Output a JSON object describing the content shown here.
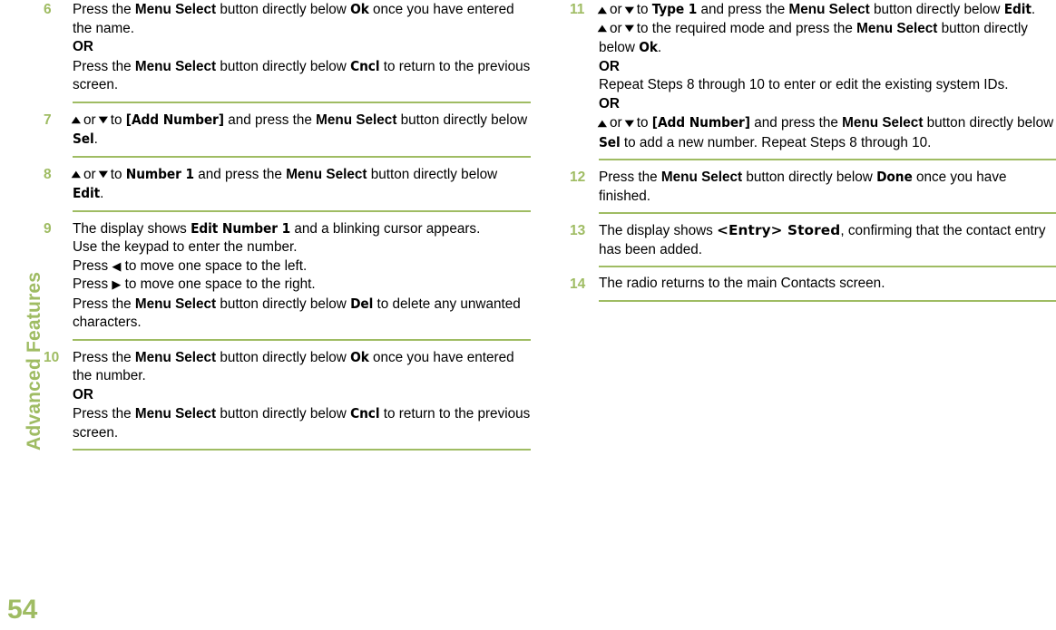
{
  "chapter": {
    "label": "Advanced Features",
    "page_number": "54",
    "accent_color": "#9fbc63"
  },
  "left_column": {
    "steps": [
      {
        "number": "6",
        "lines": [
          [
            {
              "t": "Press the ",
              "s": "plain"
            },
            {
              "t": "Menu Select",
              "s": "ui"
            },
            {
              "t": " button directly below ",
              "s": "plain"
            },
            {
              "t": "Ok",
              "s": "screen"
            },
            {
              "t": " once you have entered the name.",
              "s": "plain"
            }
          ],
          [
            {
              "t": "OR",
              "s": "or"
            }
          ],
          [
            {
              "t": "Press the ",
              "s": "plain"
            },
            {
              "t": "Menu Select",
              "s": "ui"
            },
            {
              "t": " button directly below ",
              "s": "plain"
            },
            {
              "t": "Cncl",
              "s": "screen"
            },
            {
              "t": " to return to the previous screen.",
              "s": "plain"
            }
          ]
        ]
      },
      {
        "number": "7",
        "lines": [
          [
            {
              "t": "▲",
              "s": "nav-vert"
            },
            {
              "t": " or ",
              "s": "plain"
            },
            {
              "t": "▼",
              "s": "nav-vert"
            },
            {
              "t": " to ",
              "s": "plain"
            },
            {
              "t": "[Add Number]",
              "s": "screen"
            },
            {
              "t": " and press the ",
              "s": "plain"
            },
            {
              "t": "Menu Select",
              "s": "ui"
            },
            {
              "t": " button directly below ",
              "s": "plain"
            },
            {
              "t": "Sel",
              "s": "screen"
            },
            {
              "t": ".",
              "s": "plain"
            }
          ]
        ]
      },
      {
        "number": "8",
        "lines": [
          [
            {
              "t": "▲",
              "s": "nav-vert"
            },
            {
              "t": " or ",
              "s": "plain"
            },
            {
              "t": "▼",
              "s": "nav-vert"
            },
            {
              "t": " to ",
              "s": "plain"
            },
            {
              "t": "Number 1",
              "s": "screen"
            },
            {
              "t": " and press the ",
              "s": "plain"
            },
            {
              "t": "Menu Select",
              "s": "ui"
            },
            {
              "t": " button directly below ",
              "s": "plain"
            },
            {
              "t": "Edit",
              "s": "screen"
            },
            {
              "t": ".",
              "s": "plain"
            }
          ]
        ]
      },
      {
        "number": "9",
        "lines": [
          [
            {
              "t": "The display shows ",
              "s": "plain"
            },
            {
              "t": "Edit Number 1",
              "s": "screen"
            },
            {
              "t": " and a blinking cursor appears.",
              "s": "plain"
            }
          ],
          [
            {
              "t": "Use the keypad to enter the number.",
              "s": "plain"
            }
          ],
          [
            {
              "t": "Press ",
              "s": "plain"
            },
            {
              "t": "◀",
              "s": "nav-horz"
            },
            {
              "t": " to move one space to the left.",
              "s": "plain"
            }
          ],
          [
            {
              "t": "Press ",
              "s": "plain"
            },
            {
              "t": "▶",
              "s": "nav-horz"
            },
            {
              "t": " to move one space to the right.",
              "s": "plain"
            }
          ],
          [
            {
              "t": "Press the ",
              "s": "plain"
            },
            {
              "t": "Menu Select",
              "s": "ui"
            },
            {
              "t": " button directly below ",
              "s": "plain"
            },
            {
              "t": "Del",
              "s": "screen"
            },
            {
              "t": " to delete any unwanted characters.",
              "s": "plain"
            }
          ]
        ]
      },
      {
        "number": "10",
        "lines": [
          [
            {
              "t": "Press the ",
              "s": "plain"
            },
            {
              "t": "Menu Select",
              "s": "ui"
            },
            {
              "t": " button directly below ",
              "s": "plain"
            },
            {
              "t": "Ok",
              "s": "screen"
            },
            {
              "t": " once you have entered the number.",
              "s": "plain"
            }
          ],
          [
            {
              "t": "OR",
              "s": "or"
            }
          ],
          [
            {
              "t": "Press the ",
              "s": "plain"
            },
            {
              "t": "Menu Select",
              "s": "ui"
            },
            {
              "t": " button directly below ",
              "s": "plain"
            },
            {
              "t": "Cncl",
              "s": "screen"
            },
            {
              "t": " to return to the previous screen.",
              "s": "plain"
            }
          ]
        ]
      }
    ]
  },
  "right_column": {
    "steps": [
      {
        "number": "11",
        "lines": [
          [
            {
              "t": "▲",
              "s": "nav-vert"
            },
            {
              "t": " or ",
              "s": "plain"
            },
            {
              "t": "▼",
              "s": "nav-vert"
            },
            {
              "t": " to ",
              "s": "plain"
            },
            {
              "t": "Type 1",
              "s": "screen"
            },
            {
              "t": " and press the ",
              "s": "plain"
            },
            {
              "t": "Menu Select",
              "s": "ui"
            },
            {
              "t": " button directly below ",
              "s": "plain"
            },
            {
              "t": "Edit",
              "s": "screen"
            },
            {
              "t": ".",
              "s": "plain"
            }
          ],
          [
            {
              "t": "▲",
              "s": "nav-vert"
            },
            {
              "t": " or ",
              "s": "plain"
            },
            {
              "t": "▼",
              "s": "nav-vert"
            },
            {
              "t": " to the required mode and press the ",
              "s": "plain"
            },
            {
              "t": "Menu Select",
              "s": "ui"
            },
            {
              "t": " button directly below ",
              "s": "plain"
            },
            {
              "t": "Ok",
              "s": "screen"
            },
            {
              "t": ".",
              "s": "plain"
            }
          ],
          [
            {
              "t": "OR",
              "s": "or"
            }
          ],
          [
            {
              "t": "Repeat Steps 8 through 10 to enter or edit the existing system IDs.",
              "s": "plain"
            }
          ],
          [
            {
              "t": "OR",
              "s": "or"
            }
          ],
          [
            {
              "t": "▲",
              "s": "nav-vert"
            },
            {
              "t": " or ",
              "s": "plain"
            },
            {
              "t": "▼",
              "s": "nav-vert"
            },
            {
              "t": " to ",
              "s": "plain"
            },
            {
              "t": "[Add Number]",
              "s": "screen"
            },
            {
              "t": " and press the ",
              "s": "plain"
            },
            {
              "t": "Menu Select",
              "s": "ui"
            },
            {
              "t": " button directly below ",
              "s": "plain"
            },
            {
              "t": "Sel",
              "s": "screen"
            },
            {
              "t": " to add a new number. Repeat Steps 8 through 10.",
              "s": "plain"
            }
          ]
        ]
      },
      {
        "number": "12",
        "lines": [
          [
            {
              "t": "Press the ",
              "s": "plain"
            },
            {
              "t": "Menu Select",
              "s": "ui"
            },
            {
              "t": " button directly below ",
              "s": "plain"
            },
            {
              "t": "Done",
              "s": "screen"
            },
            {
              "t": " once you have finished.",
              "s": "plain"
            }
          ]
        ]
      },
      {
        "number": "13",
        "lines": [
          [
            {
              "t": "The display shows ",
              "s": "plain"
            },
            {
              "t": "<Entry> Stored",
              "s": "screen-wide"
            },
            {
              "t": ", confirming that the contact entry has been added.",
              "s": "plain"
            }
          ]
        ]
      },
      {
        "number": "14",
        "lines": [
          [
            {
              "t": "The radio returns to the main Contacts screen.",
              "s": "plain"
            }
          ]
        ]
      }
    ]
  }
}
